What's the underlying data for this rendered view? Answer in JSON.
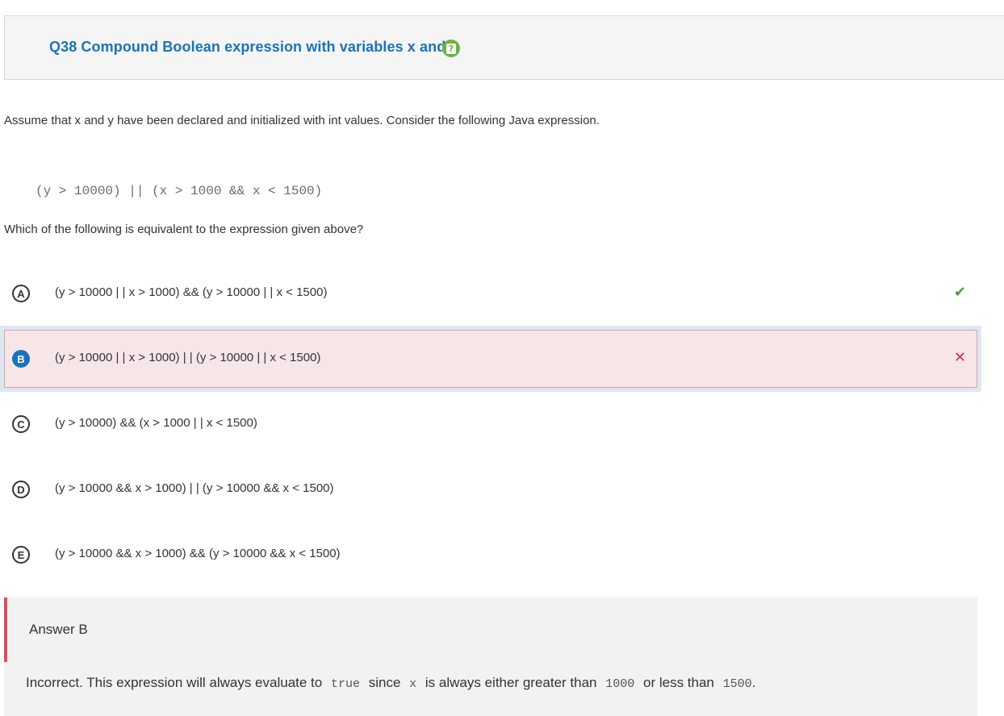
{
  "header": {
    "question_title": "Q38 Compound Boolean expression with variables x and y",
    "help_icon_glyph": "?"
  },
  "intro_text": "Assume that x and y have been declared and initialized with int values. Consider the following Java expression.",
  "code_expression": "(y > 10000) || (x > 1000 && x < 1500)",
  "question_text": "Which of the following is equivalent to the expression given above?",
  "options": [
    {
      "letter": "A",
      "text": "(y > 10000 | | x > 1000) && (y > 10000 | | x < 1500)",
      "mark": "✔",
      "status": "correct"
    },
    {
      "letter": "B",
      "text": "(y > 10000 | | x > 1000) | | (y > 10000 | | x < 1500)",
      "mark": "✕",
      "status": "selected-incorrect"
    },
    {
      "letter": "C",
      "text": "(y > 10000) && (x > 1000 | | x < 1500)",
      "mark": "",
      "status": "none"
    },
    {
      "letter": "D",
      "text": "(y > 10000 && x > 1000) | | (y > 10000 && x < 1500)",
      "mark": "",
      "status": "none"
    },
    {
      "letter": "E",
      "text": "(y > 10000 && x > 1000) && (y > 10000 && x < 1500)",
      "mark": "",
      "status": "none"
    }
  ],
  "answer": {
    "title": "Answer B",
    "explanation": {
      "part1": "Incorrect. This expression will always evaluate to",
      "code1": "true",
      "part2": "since",
      "code2": "x",
      "part3": "is always either greater than",
      "code3": "1000",
      "part4": "or less than",
      "code4": "1500",
      "part5": "."
    }
  },
  "colors": {
    "title_blue": "#1a73b8",
    "help_green": "#6cb33f",
    "correct_green": "#4a9d3e",
    "wrong_red": "#d0334a",
    "answer_bar_red": "#d94f5e"
  }
}
